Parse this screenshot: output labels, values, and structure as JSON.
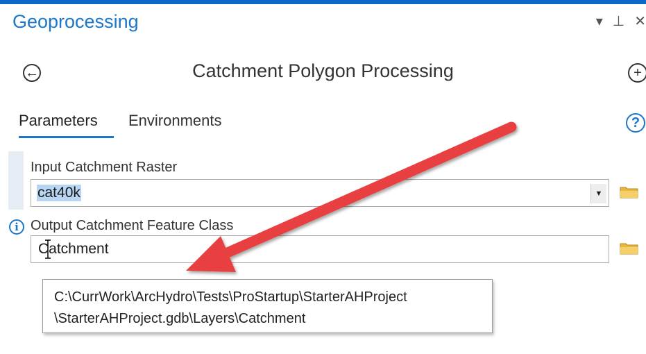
{
  "pane": {
    "title": "Geoprocessing",
    "controls": [
      "▾",
      "⊥",
      "✕"
    ]
  },
  "tool": {
    "title": "Catchment Polygon Processing"
  },
  "tabs": [
    {
      "label": "Parameters",
      "active": true
    },
    {
      "label": "Environments",
      "active": false
    }
  ],
  "params": {
    "input_raster": {
      "label": "Input Catchment Raster",
      "value": "cat40k"
    },
    "output_fc": {
      "label": "Output Catchment Feature Class",
      "value": "Catchment"
    }
  },
  "tooltip": {
    "line1": "C:\\CurrWork\\ArcHydro\\Tests\\ProStartup\\StarterAHProject",
    "line2": "\\StarterAHProject.gdb\\Layers\\Catchment"
  },
  "icons": {
    "back": "back-arrow-icon",
    "add": "plus-icon",
    "help": "help-icon",
    "info": "info-icon",
    "folder": "folder-icon",
    "dropdown": "chevron-down-icon"
  },
  "colors": {
    "accent": "#1b77c9",
    "annotation_arrow": "#e8403f",
    "selection": "#b8d5f2",
    "folder": "#e8b73c"
  },
  "glyphs": {
    "back": "←",
    "add": "+",
    "help": "?",
    "info": "i",
    "dropdown": "▼"
  }
}
